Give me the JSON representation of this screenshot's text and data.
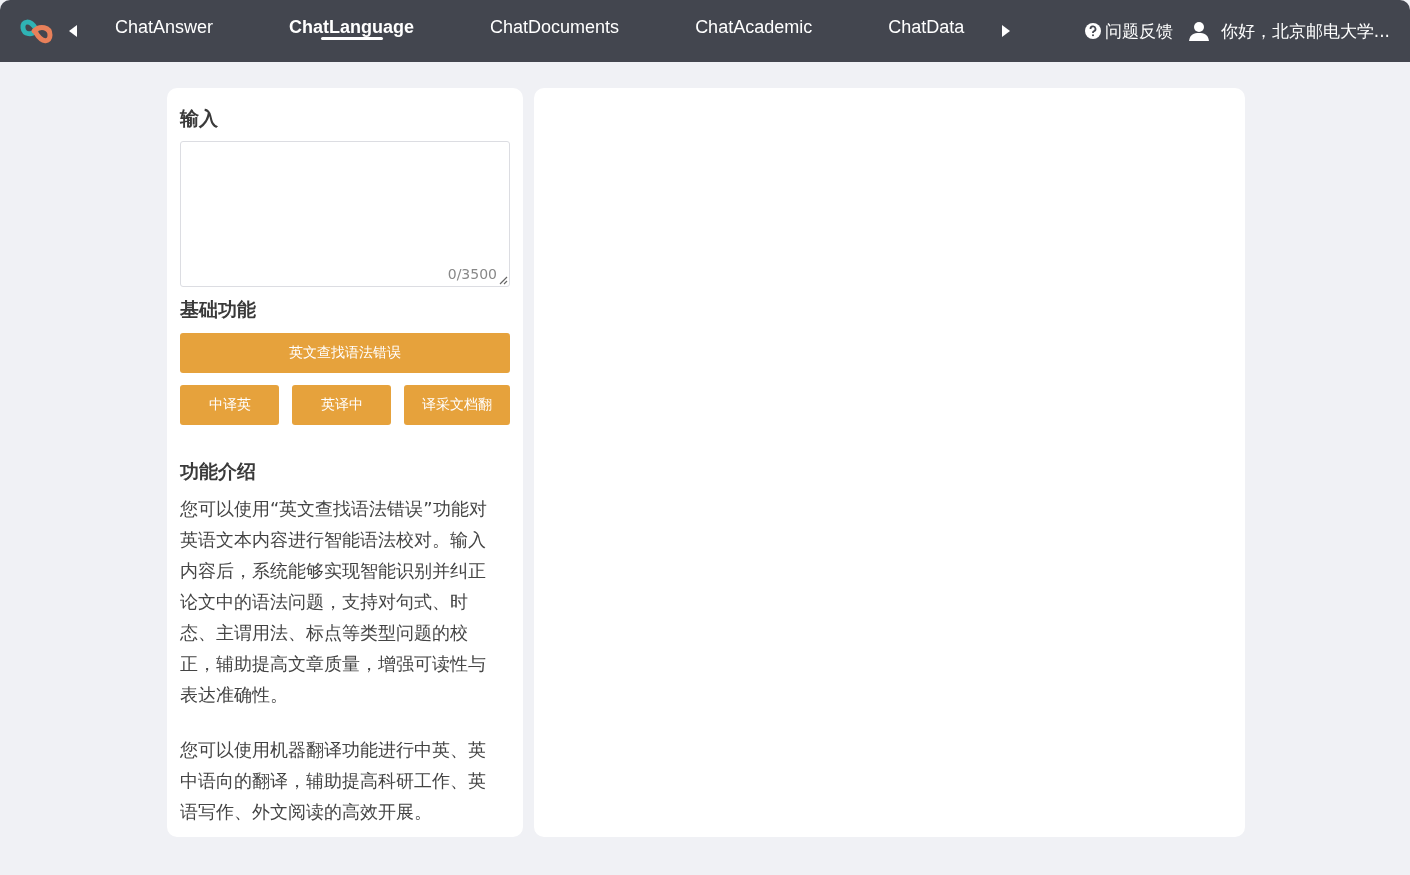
{
  "nav": {
    "tabs": [
      {
        "label": "ChatAnswer",
        "selected": false
      },
      {
        "label": "ChatLanguage",
        "selected": true
      },
      {
        "label": "ChatDocuments",
        "selected": false
      },
      {
        "label": "ChatAcademic",
        "selected": false
      },
      {
        "label": "ChatData",
        "selected": false
      }
    ],
    "feedback": "问题反馈",
    "user": "你好，北京邮电大学..."
  },
  "input": {
    "title": "输入",
    "counter": "0/3500"
  },
  "basic": {
    "title": "基础功能",
    "primary": "英文查找语法错误",
    "buttons": [
      "中译英",
      "英译中",
      "译采文档翻"
    ]
  },
  "intro": {
    "title": "功能介绍",
    "paragraphs": [
      "您可以使用“英文查找语法错误”功能对英语文本内容进行智能语法校对。输入内容后，系统能够实现智能识别并纠正论文中的语法问题，支持对句式、时态、主谓用法、标点等类型问题的校正，辅助提高文章质量，增强可读性与表达准确性。",
      "您可以使用机器翻译功能进行中英、英中语向的翻译，辅助提高科研工作、英语写作、外文阅读的高效开展。"
    ]
  }
}
